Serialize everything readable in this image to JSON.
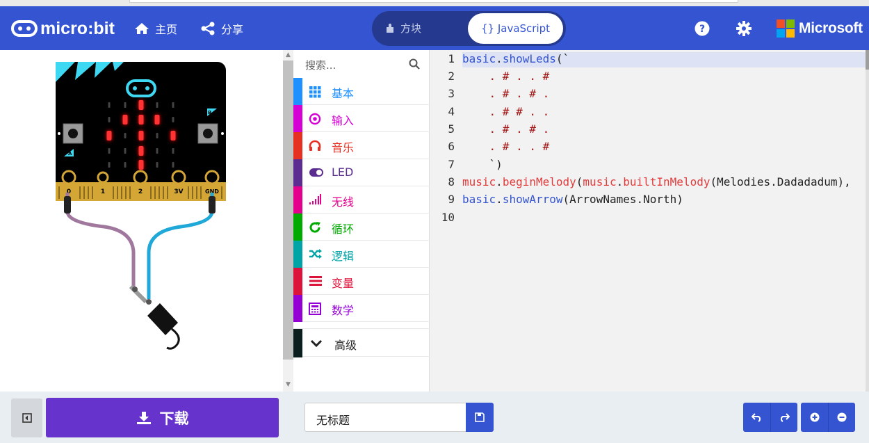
{
  "header": {
    "logo_text": "micro:bit",
    "home_label": "主页",
    "share_label": "分享",
    "blocks_label": "方块",
    "js_label": "{} JavaScript",
    "microsoft_label": "Microsoft",
    "colors": {
      "header_bg": "#3454d1",
      "toggle_bg": "#253a8e"
    }
  },
  "toolbox": {
    "search_placeholder": "搜索...",
    "categories": [
      {
        "label": "基本",
        "color": "#1e90ff",
        "icon": "grid-icon"
      },
      {
        "label": "输入",
        "color": "#d400d4",
        "icon": "target-icon"
      },
      {
        "label": "音乐",
        "color": "#e63022",
        "icon": "headphones-icon"
      },
      {
        "label": "LED",
        "color": "#5c2d91",
        "icon": "toggle-icon"
      },
      {
        "label": "无线",
        "color": "#e3008c",
        "icon": "signal-icon"
      },
      {
        "label": "循环",
        "color": "#00aa00",
        "icon": "refresh-icon"
      },
      {
        "label": "逻辑",
        "color": "#00a4a6",
        "icon": "shuffle-icon"
      },
      {
        "label": "变量",
        "color": "#dc143c",
        "icon": "list-icon"
      },
      {
        "label": "数学",
        "color": "#9400d3",
        "icon": "calculator-icon"
      }
    ],
    "advanced_label": "高级"
  },
  "editor": {
    "lines": [
      "1",
      "2",
      "3",
      "4",
      "5",
      "6",
      "7",
      "8",
      "9",
      "10"
    ],
    "code": {
      "l1_obj": "basic",
      "l1_dot": ".",
      "l1_fn": "showLeds",
      "l1_rest": "(`",
      "l2": "    . # . . #",
      "l3": "    . # . # .",
      "l4": "    . # # . .",
      "l5": "    . # . # .",
      "l6": "    . # . . #",
      "l7": "    `)",
      "l8_obj": "music",
      "l8_dot": ".",
      "l8_fn": "beginMelody",
      "l8_p1": "(",
      "l8_obj2": "music",
      "l8_dot2": ".",
      "l8_fn2": "builtInMelody",
      "l8_rest": "(Melodies.Dadadadum),",
      "l9_obj": "basic",
      "l9_dot": ".",
      "l9_fn": "showArrow",
      "l9_rest": "(ArrowNames.North)"
    }
  },
  "simulator": {
    "pin_labels": [
      "0",
      "1",
      "2",
      "3V",
      "GND"
    ],
    "button_a": "A",
    "button_b": "B",
    "led_on": [
      [
        0,
        0,
        1,
        0,
        0
      ],
      [
        0,
        1,
        1,
        1,
        0
      ],
      [
        1,
        0,
        1,
        0,
        1
      ],
      [
        0,
        0,
        1,
        0,
        0
      ],
      [
        0,
        0,
        1,
        0,
        0
      ]
    ]
  },
  "footer": {
    "download_label": "下载",
    "filename": "无标题"
  }
}
